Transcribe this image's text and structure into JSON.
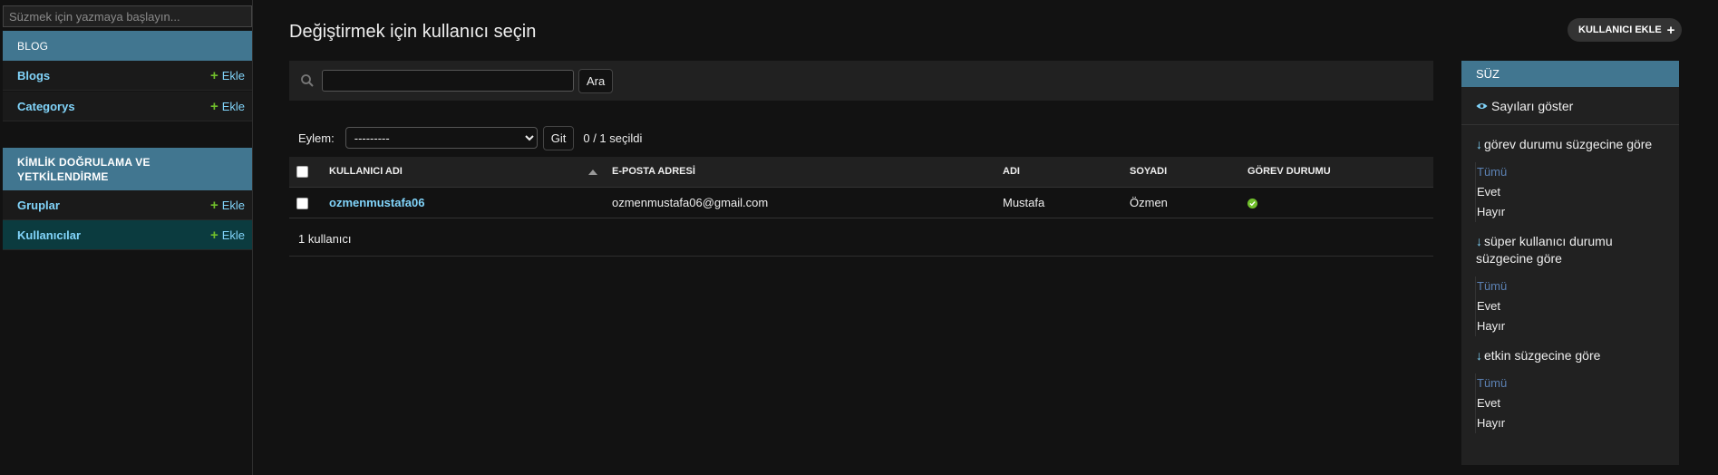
{
  "sidebar": {
    "filter_placeholder": "Süzmek için yazmaya başlayın...",
    "modules": [
      {
        "caption": "BLOG",
        "items": [
          {
            "label": "Blogs",
            "add_label": "Ekle"
          },
          {
            "label": "Categorys",
            "add_label": "Ekle"
          }
        ]
      },
      {
        "caption": "KİMLİK DOĞRULAMA VE YETKİLENDİRME",
        "items": [
          {
            "label": "Gruplar",
            "add_label": "Ekle"
          },
          {
            "label": "Kullanıcılar",
            "add_label": "Ekle",
            "current": true
          }
        ]
      }
    ]
  },
  "main": {
    "title": "Değiştirmek için kullanıcı seçin",
    "add_button": "KULLANICI EKLE",
    "search": {
      "value": "",
      "button": "Ara"
    },
    "actions": {
      "label": "Eylem:",
      "selected_option": "---------",
      "go_button": "Git",
      "selected_count": "0 / 1 seçildi"
    },
    "table": {
      "columns": [
        "KULLANICI ADI",
        "E-POSTA ADRESİ",
        "ADI",
        "SOYADI",
        "GÖREV DURUMU"
      ],
      "rows": [
        {
          "username": "ozmenmustafa06",
          "email": "ozmenmustafa06@gmail.com",
          "first_name": "Mustafa",
          "last_name": "Özmen",
          "is_staff": true
        }
      ]
    },
    "paginator": "1 kullanıcı"
  },
  "filter": {
    "title": "SÜZ",
    "show_counts": "Sayıları göster",
    "groups": [
      {
        "heading": "görev durumu süzgecine göre",
        "options": [
          "Tümü",
          "Evet",
          "Hayır"
        ],
        "selected": "Tümü"
      },
      {
        "heading": "süper kullanıcı durumu süzgecine göre",
        "options": [
          "Tümü",
          "Evet",
          "Hayır"
        ],
        "selected": "Tümü"
      },
      {
        "heading": "etkin süzgecine göre",
        "options": [
          "Tümü",
          "Evet",
          "Hayır"
        ],
        "selected": "Tümü"
      }
    ]
  },
  "colors": {
    "background": "#121212",
    "module_header": "#417690",
    "link": "#81d4fa",
    "add_green": "#70bf2b",
    "current_row": "#0b3b3f"
  },
  "icons": [
    "search-icon",
    "plus-icon",
    "eye-icon",
    "arrow-down-icon",
    "check-circle-icon",
    "sort-ascending-icon"
  ]
}
